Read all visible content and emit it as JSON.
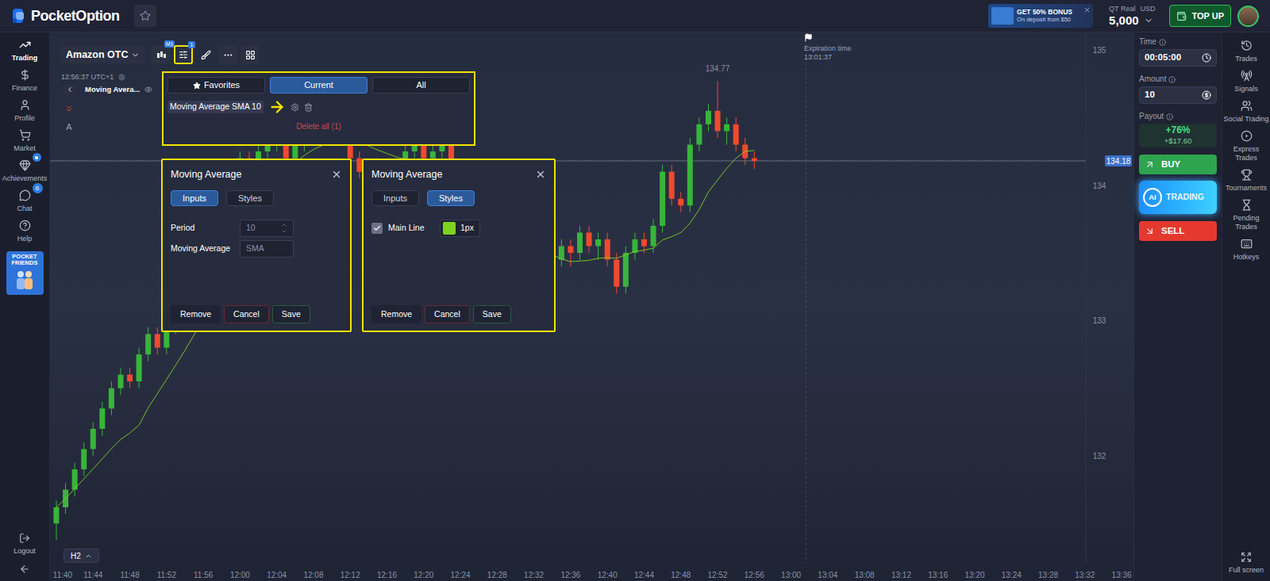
{
  "header": {
    "logo": "PocketOption",
    "bonus": {
      "title": "GET 50% BONUS",
      "subtitle": "On deposit from $50"
    },
    "account": {
      "type": "QT Real",
      "currency": "USD",
      "balance": "5,000"
    },
    "top_up": "TOP UP"
  },
  "left_nav": {
    "items": [
      {
        "label": "Trading",
        "selected": true,
        "badge": null,
        "alert": false
      },
      {
        "label": "Finance",
        "selected": false,
        "badge": null,
        "alert": false
      },
      {
        "label": "Profile",
        "selected": false,
        "badge": null,
        "alert": false
      },
      {
        "label": "Market",
        "selected": false,
        "badge": null,
        "alert": false
      },
      {
        "label": "Achievements",
        "selected": false,
        "badge": null,
        "alert": true
      },
      {
        "label": "Chat",
        "selected": false,
        "badge": "6",
        "alert": false
      },
      {
        "label": "Help",
        "selected": false,
        "badge": null,
        "alert": false
      }
    ],
    "promo": "POCKET FRIENDS",
    "logout": "Logout"
  },
  "toolbar": {
    "asset": "Amazon OTC",
    "chart_type_badge": "M1",
    "indicators_badge": "1",
    "indicators_highlighted": true
  },
  "chart": {
    "clock": "12:56:37 UTC+1",
    "legend": "Moving Avera...",
    "text_tool": "A",
    "timeframe": "H2",
    "expiration": {
      "label": "Expiration time",
      "time": "13:01:37"
    },
    "price_ticks": [
      "135",
      "134",
      "133",
      "132"
    ],
    "current_price": "134.18",
    "high_label": "134.77",
    "time_ticks": [
      "11:40",
      "11:44",
      "11:48",
      "11:52",
      "11:56",
      "12:00",
      "12:04",
      "12:08",
      "12:12",
      "12:16",
      "12:20",
      "12:24",
      "12:28",
      "12:32",
      "12:36",
      "12:40",
      "12:44",
      "12:48",
      "12:52",
      "12:56",
      "13:00",
      "13:04",
      "13:08",
      "13:12",
      "13:16",
      "13:20",
      "13:24",
      "13:28",
      "13:32",
      "13:36"
    ],
    "candles_ohlc": [
      [
        131.5,
        131.67,
        131.38,
        131.62
      ],
      [
        131.62,
        131.8,
        131.57,
        131.75
      ],
      [
        131.75,
        131.95,
        131.7,
        131.9
      ],
      [
        131.9,
        132.1,
        131.85,
        132.05
      ],
      [
        132.05,
        132.25,
        132.0,
        132.2
      ],
      [
        132.2,
        132.4,
        132.15,
        132.35
      ],
      [
        132.35,
        132.55,
        132.3,
        132.5
      ],
      [
        132.5,
        132.65,
        132.45,
        132.6
      ],
      [
        132.6,
        132.65,
        132.5,
        132.55
      ],
      [
        132.55,
        132.8,
        132.5,
        132.75
      ],
      [
        132.75,
        132.95,
        132.7,
        132.9
      ],
      [
        132.9,
        132.95,
        132.75,
        132.8
      ],
      [
        132.8,
        133.0,
        132.75,
        132.95
      ],
      [
        132.95,
        133.15,
        132.9,
        133.1
      ],
      [
        133.1,
        133.35,
        133.05,
        133.3
      ],
      [
        133.3,
        133.55,
        133.25,
        133.5
      ],
      [
        133.5,
        133.75,
        133.45,
        133.7
      ],
      [
        133.7,
        133.9,
        133.65,
        133.85
      ],
      [
        133.85,
        134.05,
        133.8,
        134.0
      ],
      [
        134.0,
        134.15,
        133.95,
        134.1
      ],
      [
        134.1,
        134.25,
        134.05,
        134.2
      ],
      [
        134.2,
        134.25,
        134.05,
        134.1
      ],
      [
        134.1,
        134.3,
        134.05,
        134.25
      ],
      [
        134.25,
        134.35,
        134.2,
        134.3
      ],
      [
        134.3,
        134.4,
        134.25,
        134.35
      ],
      [
        134.35,
        134.4,
        134.15,
        134.2
      ],
      [
        134.2,
        134.35,
        134.15,
        134.3
      ],
      [
        134.3,
        134.45,
        134.25,
        134.4
      ],
      [
        134.4,
        134.5,
        134.35,
        134.45
      ],
      [
        134.45,
        134.5,
        134.35,
        134.4
      ],
      [
        134.4,
        134.55,
        134.35,
        134.5
      ],
      [
        134.5,
        134.55,
        134.3,
        134.35
      ],
      [
        134.35,
        134.4,
        134.15,
        134.2
      ],
      [
        134.2,
        134.25,
        134.05,
        134.1
      ],
      [
        134.1,
        134.15,
        133.95,
        134.0
      ],
      [
        134.0,
        134.05,
        133.85,
        133.9
      ],
      [
        133.9,
        134.1,
        133.85,
        134.05
      ],
      [
        134.05,
        134.2,
        134.0,
        134.15
      ],
      [
        134.15,
        134.3,
        134.1,
        134.25
      ],
      [
        134.25,
        134.35,
        134.2,
        134.3
      ],
      [
        134.3,
        134.35,
        134.15,
        134.2
      ],
      [
        134.2,
        134.3,
        134.15,
        134.25
      ],
      [
        134.25,
        134.35,
        134.2,
        134.3
      ],
      [
        134.3,
        134.35,
        134.1,
        134.15
      ],
      [
        134.15,
        134.2,
        133.95,
        134.0
      ],
      [
        134.0,
        134.05,
        133.8,
        133.85
      ],
      [
        133.85,
        133.9,
        133.65,
        133.7
      ],
      [
        133.7,
        133.75,
        133.55,
        133.6
      ],
      [
        133.6,
        133.65,
        133.45,
        133.5
      ],
      [
        133.5,
        133.55,
        133.4,
        133.45
      ],
      [
        133.45,
        133.5,
        133.35,
        133.4
      ],
      [
        133.4,
        133.45,
        133.25,
        133.3
      ],
      [
        133.3,
        133.35,
        133.15,
        133.25
      ],
      [
        133.25,
        133.4,
        133.2,
        133.35
      ],
      [
        133.35,
        133.5,
        133.3,
        133.45
      ],
      [
        133.45,
        133.6,
        133.4,
        133.55
      ],
      [
        133.55,
        133.6,
        133.4,
        133.5
      ],
      [
        133.5,
        133.7,
        133.45,
        133.65
      ],
      [
        133.65,
        133.7,
        133.5,
        133.55
      ],
      [
        133.55,
        133.65,
        133.45,
        133.6
      ],
      [
        133.6,
        133.65,
        133.4,
        133.45
      ],
      [
        133.45,
        133.5,
        133.2,
        133.25
      ],
      [
        133.25,
        133.55,
        133.2,
        133.5
      ],
      [
        133.5,
        133.65,
        133.45,
        133.6
      ],
      [
        133.6,
        133.65,
        133.5,
        133.55
      ],
      [
        133.55,
        133.75,
        133.5,
        133.7
      ],
      [
        133.7,
        134.15,
        133.65,
        134.1
      ],
      [
        134.1,
        134.15,
        133.85,
        133.9
      ],
      [
        133.9,
        133.95,
        133.8,
        133.85
      ],
      [
        133.85,
        134.35,
        133.8,
        134.3
      ],
      [
        134.3,
        134.5,
        134.25,
        134.45
      ],
      [
        134.45,
        134.6,
        134.4,
        134.55
      ],
      [
        134.55,
        134.77,
        134.35,
        134.4
      ],
      [
        134.4,
        134.5,
        134.3,
        134.45
      ],
      [
        134.45,
        134.5,
        134.25,
        134.3
      ],
      [
        134.3,
        134.35,
        134.15,
        134.2
      ],
      [
        134.2,
        134.25,
        134.12,
        134.18
      ]
    ]
  },
  "indicator_panel": {
    "highlighted": true,
    "tabs": [
      {
        "label": "Favorites",
        "selected": false
      },
      {
        "label": "Current",
        "selected": true
      },
      {
        "label": "All",
        "selected": false
      }
    ],
    "items": [
      {
        "label": "Moving Average SMA 10",
        "pointed": true
      }
    ],
    "delete_all": "Delete all (1)"
  },
  "dialogs": [
    {
      "kind": "inputs",
      "highlighted": true,
      "title": "Moving Average",
      "tabs": [
        {
          "label": "Inputs",
          "selected": true
        },
        {
          "label": "Styles",
          "selected": false
        }
      ],
      "fields": [
        {
          "label": "Period",
          "value": "10",
          "kind": "number"
        },
        {
          "label": "Moving Average",
          "value": "SMA",
          "kind": "select"
        }
      ],
      "buttons": [
        "Remove",
        "Cancel",
        "Save"
      ]
    },
    {
      "kind": "styles",
      "highlighted": true,
      "title": "Moving Average",
      "tabs": [
        {
          "label": "Inputs",
          "selected": false
        },
        {
          "label": "Styles",
          "selected": true
        }
      ],
      "lines": [
        {
          "label": "Main Line",
          "checked": true,
          "color": "#7ed321",
          "width": "1px"
        }
      ],
      "buttons": [
        "Remove",
        "Cancel",
        "Save"
      ]
    }
  ],
  "trade_panel": {
    "time": {
      "label": "Time",
      "value": "00:05:00"
    },
    "amount": {
      "label": "Amount",
      "value": "10"
    },
    "payout": {
      "label": "Payout",
      "percent": "+76%",
      "profit": "+$17.60"
    },
    "buy": "BUY",
    "ai": {
      "badge": "AI",
      "label": "TRADING"
    },
    "sell": "SELL"
  },
  "right_nav": {
    "items": [
      "Trades",
      "Signals",
      "Social Trading",
      "Express Trades",
      "Tournaments",
      "Pending Trades",
      "Hotkeys"
    ],
    "full_screen": "Full screen"
  }
}
